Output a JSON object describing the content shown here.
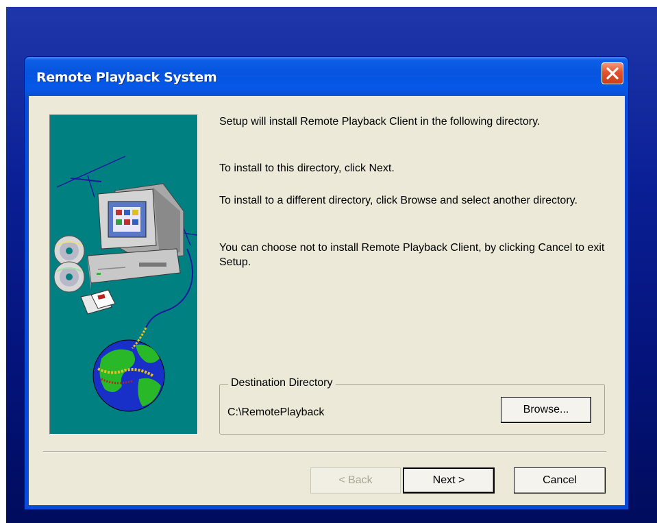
{
  "window": {
    "title": "Remote Playback System"
  },
  "messages": {
    "line1": "Setup will install Remote Playback Client in the following directory.",
    "line2": "To install to this directory, click Next.",
    "line3": "To install to a different directory, click Browse and select another directory.",
    "line4": "You can choose not to install Remote Playback Client, by clicking Cancel to exit Setup."
  },
  "destination": {
    "group_label": "Destination Directory",
    "path": "C:\\RemotePlayback",
    "browse_label": "Browse..."
  },
  "buttons": {
    "back_label": "< Back",
    "next_label": "Next >",
    "cancel_label": "Cancel"
  },
  "icons": {
    "close": "close-icon",
    "art": "setup-computer-globe-illustration"
  },
  "colors": {
    "titlebar": "#0754df",
    "client_bg": "#ece9d8",
    "art_bg": "#008080",
    "close_button": "#e2512c"
  }
}
